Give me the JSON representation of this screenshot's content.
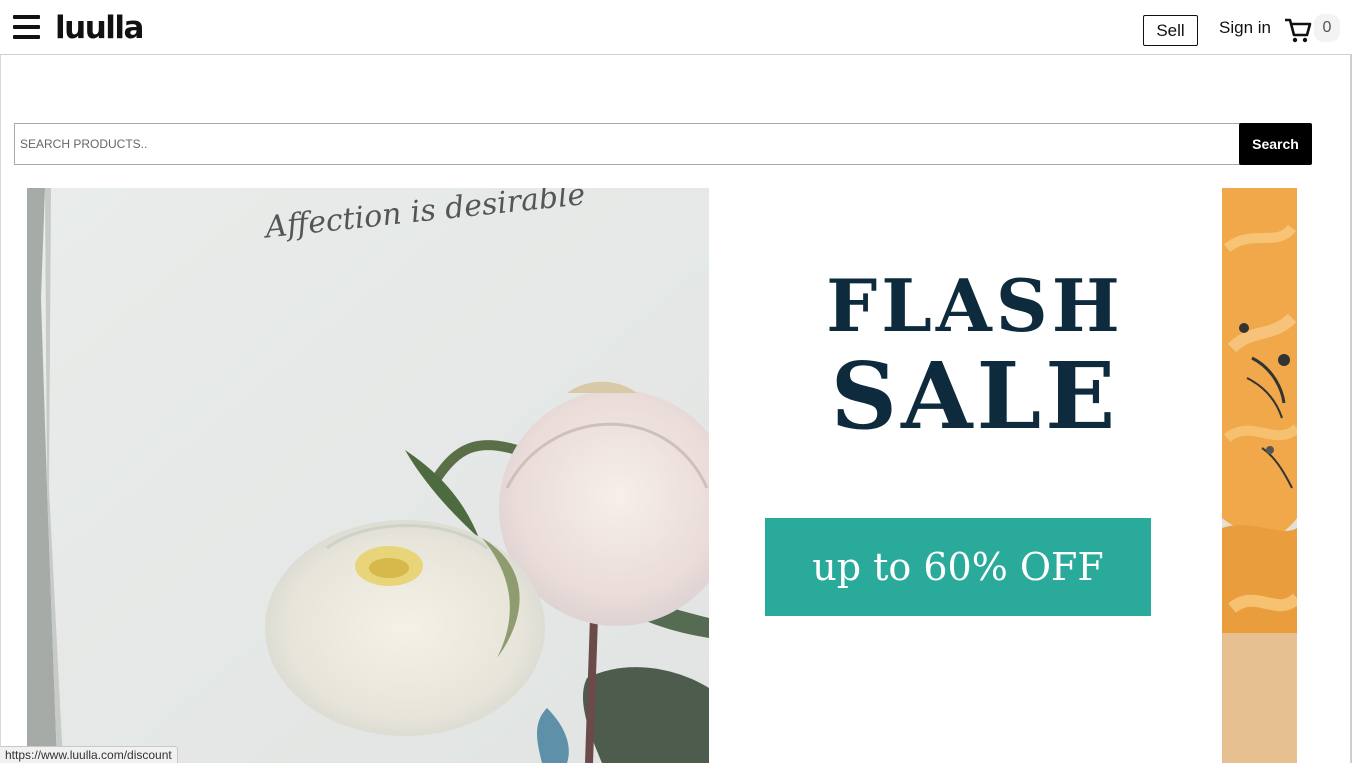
{
  "header": {
    "logo": "luulla",
    "sell_label": "Sell",
    "signin_label": "Sign in",
    "cart_count": "0"
  },
  "search": {
    "placeholder": "SEARCH PRODUCTS..",
    "button_label": "Search"
  },
  "banner": {
    "photo_caption": "Affection is desirable",
    "title_line1": "FLASH",
    "title_line2": "SALE",
    "discount_label": "up to 60% OFF",
    "accent_color": "#2aaa9a",
    "title_color": "#0d2b3c"
  },
  "status_bar": {
    "url": "https://www.luulla.com/discount"
  },
  "icons": [
    "hamburger-menu-icon",
    "cart-icon"
  ]
}
